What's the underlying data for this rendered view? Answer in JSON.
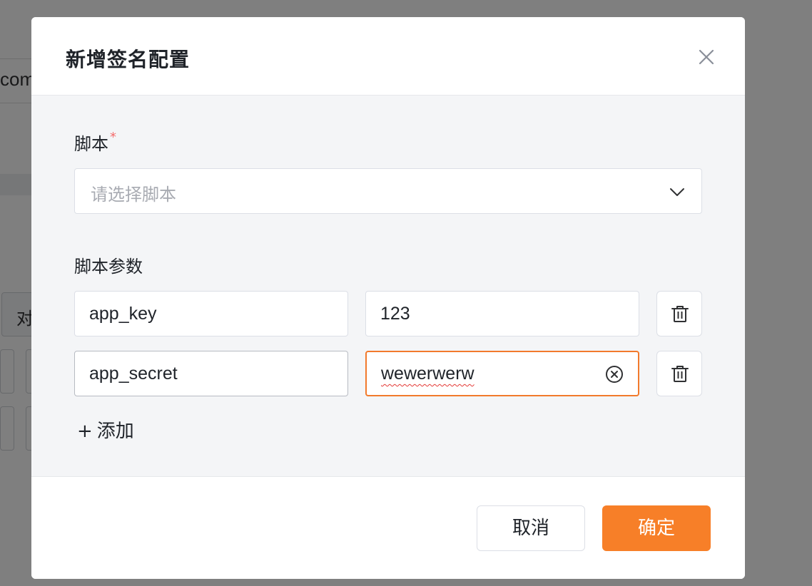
{
  "background": {
    "partial_text_top": "com",
    "partial_button_text": "对"
  },
  "dialog": {
    "title": "新增签名配置",
    "close_icon": "close-icon",
    "script_field": {
      "label": "脚本",
      "required_mark": "*",
      "placeholder": "请选择脚本",
      "arrow_icon": "chevron-down-icon"
    },
    "params": {
      "label": "脚本参数",
      "rows": [
        {
          "key": "app_key",
          "value": "123"
        },
        {
          "key": "app_secret",
          "value": "wewerwerw"
        }
      ],
      "delete_icon": "trash-icon",
      "clear_icon": "clear-circle-icon",
      "add_plus": "+",
      "add_label": "添加"
    },
    "footer": {
      "cancel_label": "取消",
      "ok_label": "确定"
    }
  },
  "colors": {
    "accent": "#f77f28",
    "focus_border": "#f27a2c",
    "required": "#f56c6c",
    "overlay": "#7d7d7d"
  }
}
